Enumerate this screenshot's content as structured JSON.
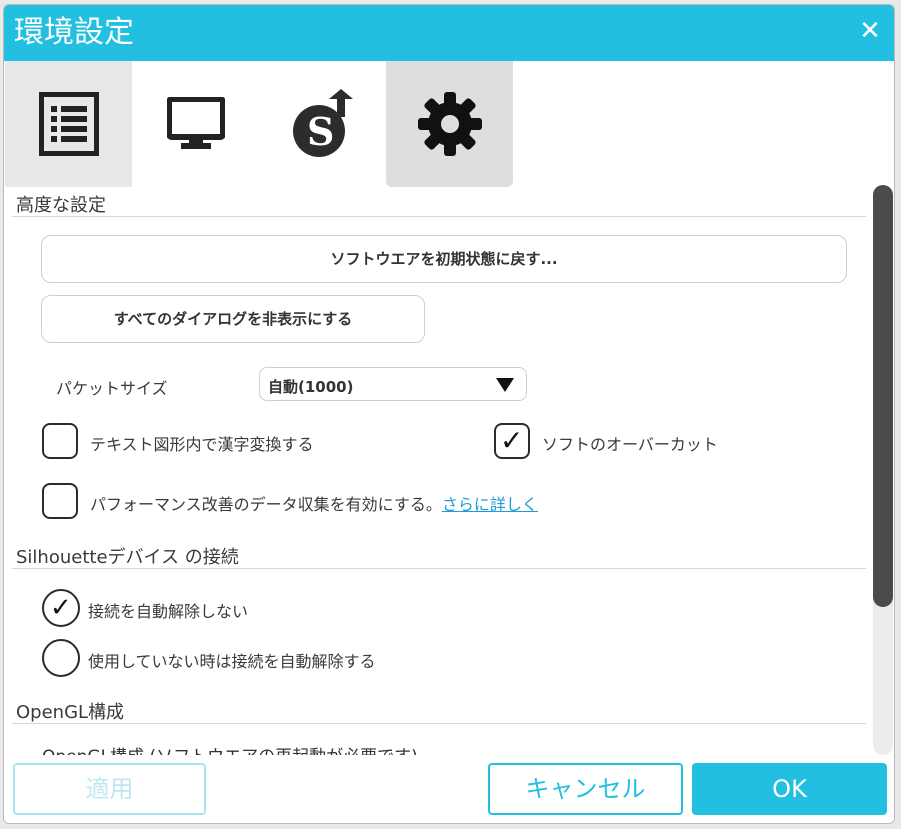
{
  "window": {
    "title": "環境設定",
    "close_icon": "close-icon"
  },
  "tabs": [
    {
      "name": "general",
      "icon": "list-icon"
    },
    {
      "name": "display",
      "icon": "monitor-icon"
    },
    {
      "name": "store",
      "icon": "silhouette-upload-icon"
    },
    {
      "name": "advanced",
      "icon": "gear-icon"
    }
  ],
  "advanced": {
    "heading": "高度な設定",
    "reset_button": "ソフトウエアを初期状態に戻す...",
    "hide_dialogs_button": "すべてのダイアログを非表示にする",
    "packet_size_label": "パケットサイズ",
    "packet_size_value": "自動(1000)",
    "kanji_convert_label": "テキスト図形内で漢字変換する",
    "kanji_convert_checked": false,
    "software_overcut_label": "ソフトのオーバーカット",
    "software_overcut_checked": true,
    "perf_data_label": "パフォーマンス改善のデータ収集を有効にする。",
    "perf_data_link": "さらに詳しく",
    "perf_data_checked": false
  },
  "connection": {
    "heading": "Silhouetteデバイス の接続",
    "options": [
      {
        "label": "接続を自動解除しない",
        "selected": true
      },
      {
        "label": "使用していない時は接続を自動解除する",
        "selected": false
      }
    ]
  },
  "opengl": {
    "heading": "OpenGL構成",
    "subtext": "OpenGL構成 (ソフトウエアの再起動が必要です)"
  },
  "footer": {
    "apply": "適用",
    "cancel": "キャンセル",
    "ok": "OK"
  },
  "colors": {
    "accent": "#22bfe0",
    "link": "#1e9bd8"
  }
}
